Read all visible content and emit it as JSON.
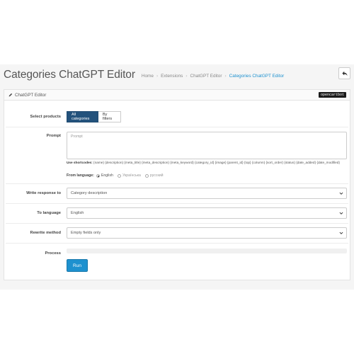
{
  "page": {
    "title": "Categories ChatGPT Editor",
    "breadcrumb": [
      "Home",
      "Extensions",
      "ChatGPT Editor",
      "Categories ChatGPT Editor"
    ]
  },
  "panel": {
    "title": "ChatGPT Editor",
    "badge": "opencartbot"
  },
  "form": {
    "select_products": {
      "label": "Select products",
      "options": [
        "All categories",
        "By filters"
      ],
      "selected": "All categories"
    },
    "prompt": {
      "label": "Prompt",
      "placeholder": "Prompt",
      "shortcodes_label": "Use shortcodes:",
      "shortcodes": "{name} {description} {meta_title} {meta_description} {meta_keyword} {category_id} {image} {parent_id} {top} {column} {sort_order} {status} {date_added} {date_modified}",
      "from_language_label": "From language:",
      "languages": [
        "English",
        "Українська",
        "русский"
      ],
      "selected_language": "English"
    },
    "write_response_to": {
      "label": "Write response to",
      "value": "Category description"
    },
    "to_language": {
      "label": "To language",
      "value": "English"
    },
    "rewrite_method": {
      "label": "Rewrite method",
      "value": "Empty fields only"
    },
    "process": {
      "label": "Process",
      "progress": 0
    },
    "run_label": "Run"
  },
  "colors": {
    "primary": "#1e91cf",
    "active_toggle": "#23527c"
  }
}
